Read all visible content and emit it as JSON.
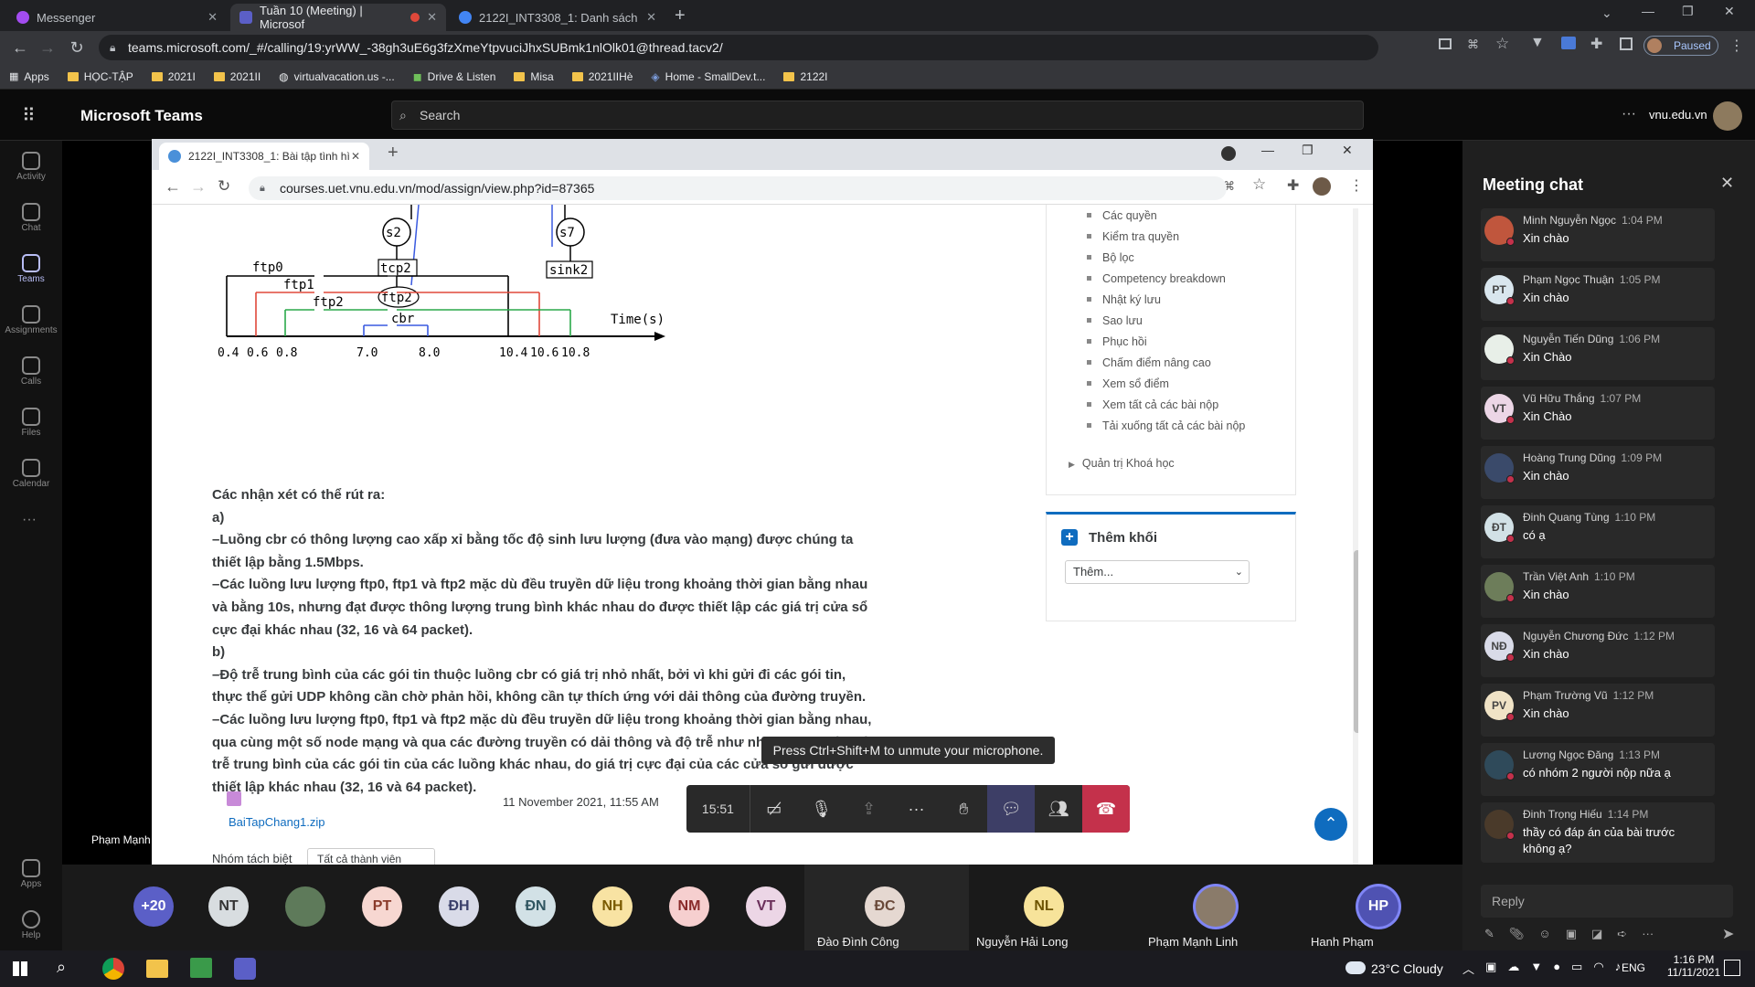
{
  "chrome": {
    "tabs": [
      {
        "title": "Messenger",
        "color": "#a34cf0"
      },
      {
        "title": "Tuần 10 (Meeting) | Microsof",
        "color": "#5b5fc7"
      },
      {
        "title": "2122I_INT3308_1: Danh sách th...",
        "color": "#4285f4"
      }
    ],
    "url": "teams.microsoft.com/_#/calling/19:yrWW_-38gh3uE6g3fzXmeYtpvuciJhxSUBmk1nlOlk01@thread.tacv2/",
    "profile_label": "Paused",
    "bookmarks": [
      "Apps",
      "HỌC-TẬP",
      "2021I",
      "2021II",
      "virtualvacation.us -...",
      "Drive & Listen",
      "Misa",
      "2021IIHè",
      "Home - SmallDev.t...",
      "2122I"
    ]
  },
  "teams": {
    "title": "Microsoft Teams",
    "search_placeholder": "Search",
    "org": "vnu.edu.vn",
    "rail": [
      "Activity",
      "Chat",
      "Teams",
      "Assignments",
      "Calls",
      "Files",
      "Calendar",
      "Apps",
      "Help"
    ],
    "more": "···"
  },
  "shared": {
    "tab_title": "2122I_INT3308_1: Bài tập tình hì",
    "url": "courses.uet.vnu.edu.vn/mod/assign/view.php?id=87365",
    "diagram": {
      "nodes": [
        "s2",
        "tcp2",
        "ftp2",
        "s7",
        "sink2"
      ],
      "flows": [
        "ftp0",
        "ftp1",
        "ftp2",
        "cbr"
      ],
      "time_label": "Time(s)",
      "ticks": [
        "0.4",
        "0.6",
        "0.8",
        "7.0",
        "8.0",
        "10.4",
        "10.6",
        "10.8"
      ]
    },
    "heading": "Các nhận xét có thể rút ra:",
    "paragraphs": [
      "a)",
      "–Luồng cbr có thông lượng cao xấp xỉ bằng tốc độ sinh lưu lượng (đưa vào mạng) được chúng ta thiết lập bằng 1.5Mbps.",
      "–Các luồng lưu lượng ftp0, ftp1 và ftp2 mặc dù đều truyền dữ liệu trong khoảng thời gian bằng nhau và bằng 10s, nhưng đạt được thông lượng trung bình khác nhau do được thiết lập các giá trị cửa sổ cực đại khác nhau (32, 16 và 64 packet).",
      "b)",
      "–Độ trễ trung bình của các gói tin thuộc luồng cbr có giá trị nhỏ nhất, bởi vì khi gửi đi các gói tin, thực thể gửi UDP không cần chờ phản hồi, không cần tự thích ứng với dải thông của đường truyền.",
      "–Các luồng lưu lượng ftp0, ftp1 và ftp2 mặc dù đều truyền dữ liệu trong khoảng thời gian bằng nhau, qua cùng một số node mạng và qua các đường truyền có dải thông và độ trễ như nhau; tuy nhiên độ trễ trung bình của các gói tin của các luồng khác nhau, do giá trị cực đại của các cửa sổ gửi được thiết lập khác nhau (32, 16 và 64 packet)."
    ],
    "attachment": "BaiTapChang1.zip",
    "date": "11 November 2021, 11:55 AM",
    "group_label": "Nhóm tách biệt",
    "group_value": "Tất cả thành viên",
    "menu": [
      "Các quyền",
      "Kiểm tra quyền",
      "Bộ lọc",
      "Competency breakdown",
      "Nhật ký lưu",
      "Sao lưu",
      "Phục hồi",
      "Chấm điểm nâng cao",
      "Xem sổ điểm",
      "Xem tất cả các bài nộp",
      "Tải xuống tất cả các bài nộp"
    ],
    "admin": "Quản trị Khoá học",
    "block_title": "Thêm khối",
    "block_select": "Thêm...",
    "presenter": "Phạm Mạnh Linh"
  },
  "call": {
    "timer": "15:51",
    "tooltip": "Press Ctrl+Shift+M to unmute your microphone."
  },
  "participants": [
    {
      "initials": "+20",
      "bg": "#5b5fc7",
      "fg": "#ffffff"
    },
    {
      "initials": "NT",
      "bg": "#d8dde0",
      "fg": "#333333"
    },
    {
      "initials": "",
      "bg": "#5e7a5a",
      "fg": "#ffffff"
    },
    {
      "initials": "PT",
      "bg": "#f7d7d1",
      "fg": "#8a3a2a"
    },
    {
      "initials": "ĐH",
      "bg": "#d9dbe8",
      "fg": "#3a3f6a"
    },
    {
      "initials": "ĐN",
      "bg": "#d2e1e6",
      "fg": "#2f5560"
    },
    {
      "initials": "NH",
      "bg": "#f8e3a3",
      "fg": "#7a5a00"
    },
    {
      "initials": "NM",
      "bg": "#f6cfcf",
      "fg": "#8a2b2b"
    },
    {
      "initials": "VT",
      "bg": "#ecd6e6",
      "fg": "#6a2f5a"
    }
  ],
  "tiles": [
    {
      "initials": "ĐC",
      "name": "Đào Đình Công",
      "bg": "#e5d8d1",
      "fg": "#6a4a3a"
    },
    {
      "initials": "NL",
      "name": "Nguyễn Hải Long",
      "bg": "#f7e39a",
      "fg": "#6e5400"
    },
    {
      "initials": "",
      "name": "Phạm Mạnh Linh",
      "bg": "#8a7b6a",
      "fg": "#ffffff"
    },
    {
      "initials": "HP",
      "name": "Hanh Phạm",
      "bg": "#4f52b2",
      "fg": "#ffffff"
    }
  ],
  "chat": {
    "title": "Meeting chat",
    "reply_placeholder": "Reply",
    "messages": [
      {
        "name": "Minh Nguyễn Ngọc",
        "time": "1:04 PM",
        "text": "Xin chào",
        "initials": "",
        "bg": "#c0563d"
      },
      {
        "name": "Phạm Ngọc Thuận",
        "time": "1:05 PM",
        "text": "Xin chào",
        "initials": "PT",
        "bg": "#d9e6ee"
      },
      {
        "name": "Nguyễn Tiến Dũng",
        "time": "1:06 PM",
        "text": "Xin Chào",
        "initials": "",
        "bg": "#e8efe8"
      },
      {
        "name": "Vũ Hữu Thắng",
        "time": "1:07 PM",
        "text": "Xin Chào",
        "initials": "VT",
        "bg": "#ecd6e6"
      },
      {
        "name": "Hoàng Trung Dũng",
        "time": "1:09 PM",
        "text": "Xin chào",
        "initials": "",
        "bg": "#3a4a6a"
      },
      {
        "name": "Đinh Quang Tùng",
        "time": "1:10 PM",
        "text": "có ạ",
        "initials": "ĐT",
        "bg": "#d2e1e6"
      },
      {
        "name": "Trần Việt Anh",
        "time": "1:10 PM",
        "text": "Xin chào",
        "initials": "",
        "bg": "#6d7d5a"
      },
      {
        "name": "Nguyễn Chương Đức",
        "time": "1:12 PM",
        "text": "Xin chào",
        "initials": "NĐ",
        "bg": "#d9dbe8"
      },
      {
        "name": "Phạm Trường Vũ",
        "time": "1:12 PM",
        "text": "Xin chào",
        "initials": "PV",
        "bg": "#f0e3c6"
      },
      {
        "name": "Lương Ngọc Đăng",
        "time": "1:13 PM",
        "text": "có nhóm 2 người nộp nữa ạ",
        "initials": "",
        "bg": "#2f4a5a"
      },
      {
        "name": "Đinh Trọng Hiếu",
        "time": "1:14 PM",
        "text": "thầy có đáp án của bài trước không ạ?",
        "initials": "",
        "bg": "#4a3a2a"
      }
    ]
  },
  "taskbar": {
    "weather": "23°C  Cloudy",
    "lang": "ENG",
    "time": "1:16 PM",
    "date": "11/11/2021"
  }
}
